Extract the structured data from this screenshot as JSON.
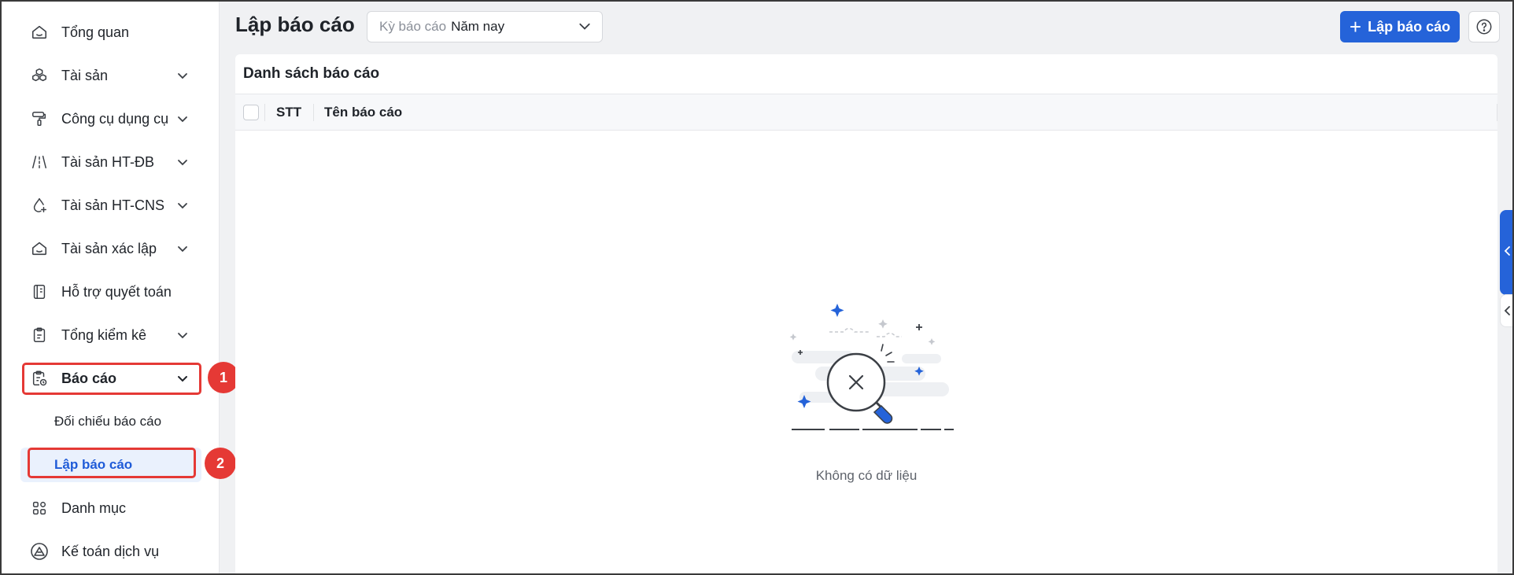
{
  "sidebar": {
    "items": [
      {
        "label": "Tổng quan",
        "icon": "home-icon",
        "has_chevron": false
      },
      {
        "label": "Tài sản",
        "icon": "cubes-icon",
        "has_chevron": true
      },
      {
        "label": "Công cụ dụng cụ",
        "icon": "paint-roller-icon",
        "has_chevron": true
      },
      {
        "label": "Tài sản HT-ĐB",
        "icon": "road-icon",
        "has_chevron": true
      },
      {
        "label": "Tài sản HT-CNS",
        "icon": "water-drop-icon",
        "has_chevron": true
      },
      {
        "label": "Tài sản xác lập",
        "icon": "inbox-icon",
        "has_chevron": true
      },
      {
        "label": "Hỗ trợ quyết toán",
        "icon": "notebook-icon",
        "has_chevron": false
      },
      {
        "label": "Tổng kiểm kê",
        "icon": "clipboard-icon",
        "has_chevron": true
      },
      {
        "label": "Báo cáo",
        "icon": "report-clock-icon",
        "has_chevron": true,
        "active": true
      },
      {
        "label": "Danh mục",
        "icon": "grid-icon",
        "has_chevron": false
      },
      {
        "label": "Kế toán dịch vụ",
        "icon": "accounting-service-icon",
        "has_chevron": false
      }
    ],
    "report_sub_items": [
      {
        "label": "Đối chiếu báo cáo",
        "selected": false
      },
      {
        "label": "Lập báo cáo",
        "selected": true
      }
    ]
  },
  "annotations": {
    "step1": "1",
    "step2": "2",
    "highlight_color": "#e53935"
  },
  "header": {
    "title": "Lập báo cáo",
    "period_select": {
      "label": "Kỳ báo cáo",
      "value": "Năm nay"
    },
    "create_button": "Lập báo cáo"
  },
  "card": {
    "title": "Danh sách báo cáo",
    "columns": [
      "STT",
      "Tên báo cáo"
    ],
    "rows": [],
    "empty_text": "Không có dữ liệu"
  },
  "colors": {
    "primary": "#2563d9",
    "selected_bg": "#eaf1fd",
    "selected_text": "#1f5bd8"
  }
}
